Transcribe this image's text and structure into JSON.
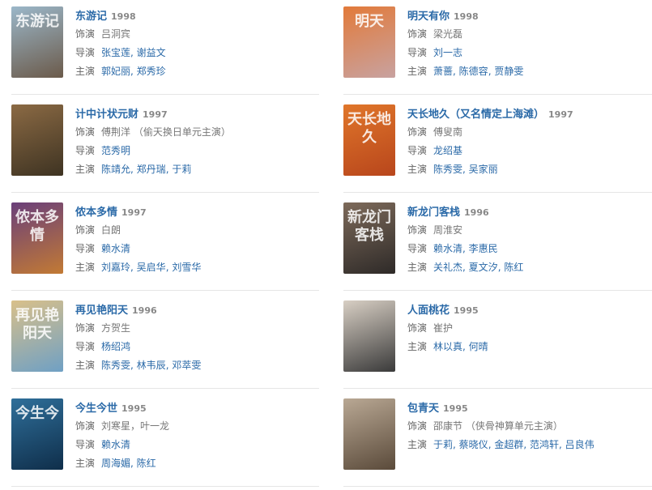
{
  "labels": {
    "role": "饰演",
    "director": "导演",
    "cast": "主演"
  },
  "films": [
    {
      "title": "东游记",
      "year": "1998",
      "role": "吕洞宾",
      "role_note": "",
      "director": [
        "张宝莲",
        "谢益文"
      ],
      "cast": [
        "郭妃丽",
        "郑秀珍"
      ],
      "poster_text": "东游记",
      "poster_colors": [
        "#9bb7c9",
        "#6b5a4a"
      ]
    },
    {
      "title": "明天有你",
      "year": "1998",
      "role": "梁光磊",
      "role_note": "",
      "director": [
        "刘一志"
      ],
      "cast": [
        "萧蔷",
        "陈德容",
        "贾静雯"
      ],
      "poster_text": "明天",
      "poster_colors": [
        "#e27a3a",
        "#c8a2a0"
      ]
    },
    {
      "title": "计中计状元财",
      "year": "1997",
      "role": "傅荆洋",
      "role_note": "（偷天换日单元主演）",
      "director": [
        "范秀明"
      ],
      "cast": [
        "陈靖允",
        "郑丹瑞",
        "于莉"
      ],
      "poster_text": "",
      "poster_colors": [
        "#8b6a44",
        "#3e3322"
      ]
    },
    {
      "title": "天长地久（又名情定上海滩）",
      "year": "1997",
      "role": "傅叟南",
      "role_note": "",
      "director": [
        "龙绍基"
      ],
      "cast": [
        "陈秀雯",
        "吴家丽"
      ],
      "poster_text": "天长地久",
      "poster_colors": [
        "#e0762a",
        "#b8461c"
      ]
    },
    {
      "title": "侬本多情",
      "year": "1997",
      "role": "白朗",
      "role_note": "",
      "director": [
        "赖水清"
      ],
      "cast": [
        "刘嘉玲",
        "吴启华",
        "刘雪华"
      ],
      "poster_text": "侬本多情",
      "poster_colors": [
        "#6a3f7a",
        "#c27a34"
      ]
    },
    {
      "title": "新龙门客栈",
      "year": "1996",
      "role": "周淮安",
      "role_note": "",
      "director": [
        "赖水清",
        "李惠民"
      ],
      "cast": [
        "关礼杰",
        "夏文汐",
        "陈红"
      ],
      "poster_text": "新龙门客栈",
      "poster_colors": [
        "#7d6a5a",
        "#2e2a28"
      ]
    },
    {
      "title": "再见艳阳天",
      "year": "1996",
      "role": "方贺生",
      "role_note": "",
      "director": [
        "杨绍鸿"
      ],
      "cast": [
        "陈秀雯",
        "林韦辰",
        "邓萃雯"
      ],
      "poster_text": "再见艳阳天",
      "poster_colors": [
        "#d9c08a",
        "#6fa0c4"
      ]
    },
    {
      "title": "人面桃花",
      "year": "1995",
      "role": "崔护",
      "role_note": "",
      "director": [],
      "cast": [
        "林以真",
        "何晴"
      ],
      "poster_text": "",
      "poster_colors": [
        "#d8cfc4",
        "#3a3a3a"
      ]
    },
    {
      "title": "今生今世",
      "year": "1995",
      "role": "刘寒星，叶一龙",
      "role_note": "",
      "director": [
        "赖水清"
      ],
      "cast": [
        "周海媚",
        "陈红"
      ],
      "poster_text": "今生今",
      "poster_colors": [
        "#2f6f9a",
        "#0f2e4a"
      ]
    },
    {
      "title": "包青天",
      "year": "1995",
      "role": "邵康节",
      "role_note": "（侠骨神算单元主演）",
      "director": [],
      "cast": [
        "于莉",
        "蔡晓仪",
        "金超群",
        "范鸿轩",
        "吕良伟"
      ],
      "poster_text": "",
      "poster_colors": [
        "#b9a894",
        "#5a4a3a"
      ]
    }
  ]
}
